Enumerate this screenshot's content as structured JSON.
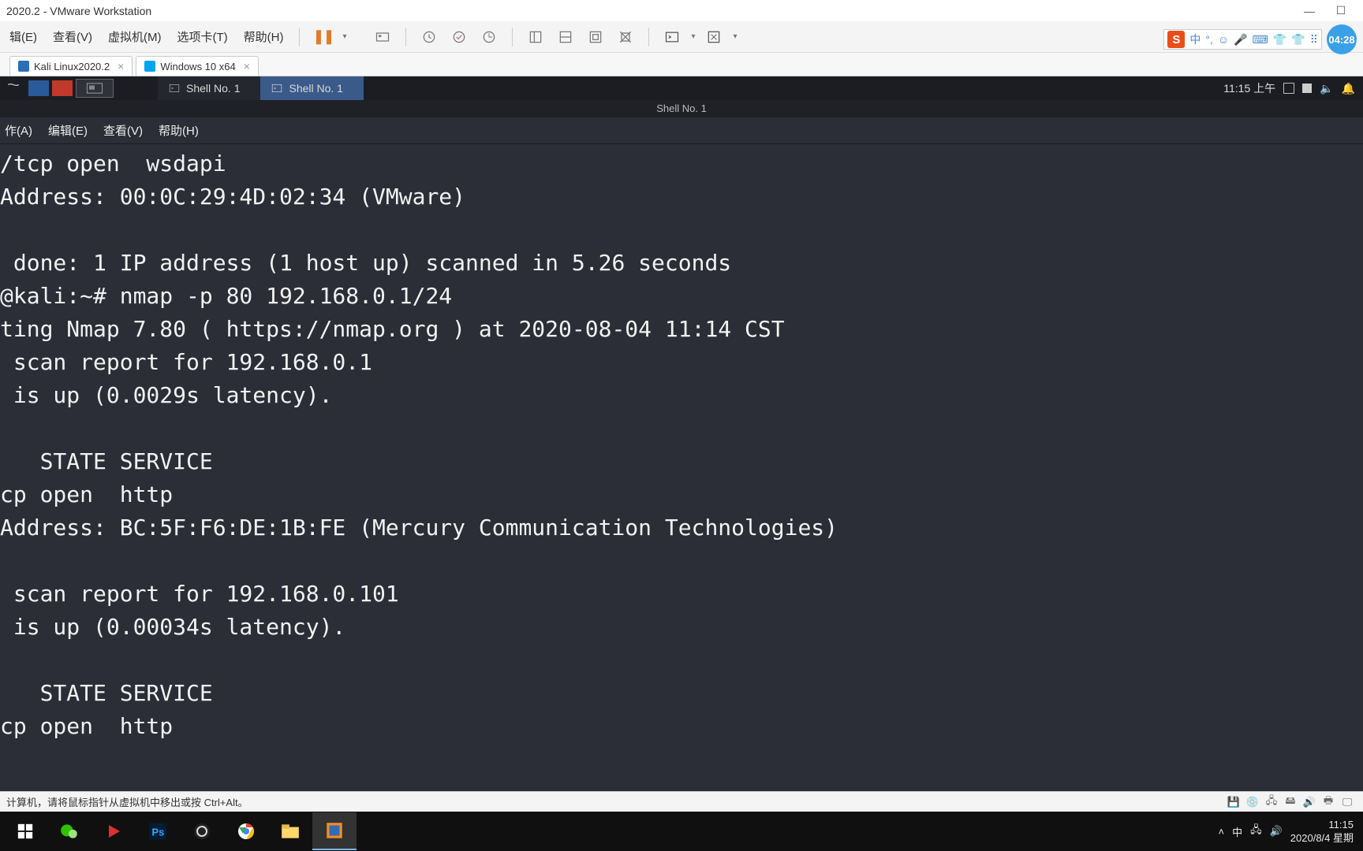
{
  "vmware": {
    "title": "2020.2 - VMware Workstation",
    "menu": [
      "辑(E)",
      "查看(V)",
      "虚拟机(M)",
      "选项卡(T)",
      "帮助(H)"
    ],
    "tabs": [
      {
        "label": "Kali Linux2020.2"
      },
      {
        "label": "Windows 10 x64"
      }
    ],
    "status": "计算机，请将鼠标指针从虚拟机中移出或按 Ctrl+Alt。",
    "badge_time": "04:28"
  },
  "ime": {
    "s": "S",
    "items": [
      "中",
      "°,",
      "☺",
      "🎤",
      "⌨",
      "👕",
      "👕",
      "⠿"
    ]
  },
  "xfce": {
    "shell_tabs": [
      "Shell No. 1",
      "Shell No. 1"
    ],
    "clock": "11:15 上午"
  },
  "terminal": {
    "title": "Shell No. 1",
    "menu": [
      "作(A)",
      "编辑(E)",
      "查看(V)",
      "帮助(H)"
    ],
    "lines": [
      "/tcp open  wsdapi",
      "Address: 00:0C:29:4D:02:34 (VMware)",
      "",
      " done: 1 IP address (1 host up) scanned in 5.26 seconds",
      "@kali:~# nmap -p 80 192.168.0.1/24",
      "ting Nmap 7.80 ( https://nmap.org ) at 2020-08-04 11:14 CST",
      " scan report for 192.168.0.1",
      " is up (0.0029s latency).",
      "",
      "   STATE SERVICE",
      "cp open  http",
      "Address: BC:5F:F6:DE:1B:FE (Mercury Communication Technologies)",
      "",
      " scan report for 192.168.0.101",
      " is up (0.00034s latency).",
      "",
      "   STATE SERVICE",
      "cp open  http"
    ]
  },
  "windows": {
    "ime_lang": "中",
    "time": "11:15",
    "date": "2020/8/4 星期"
  }
}
